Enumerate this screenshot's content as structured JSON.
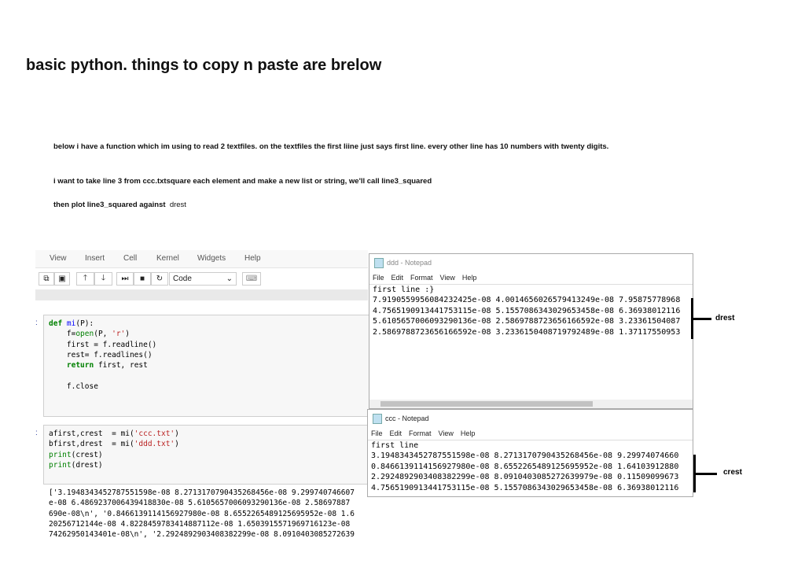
{
  "title": "basic python. things to copy n paste are brelow",
  "question": {
    "p1": "below i have a function which im using to read 2 textfiles. on the textfiles the first liine just says first line. every other line has 10 numbers with twenty digits.",
    "p2": "i want to take line 3 from ccc.txtsquare each element and make a new list or string, we'll call line3_squared",
    "p3": "then plot line3_squared against",
    "p3b": "drest"
  },
  "jupyter": {
    "menu": [
      "View",
      "Insert",
      "Cell",
      "Kernel",
      "Widgets",
      "Help"
    ],
    "cell_type": "Code",
    "prompt": ":",
    "cell1": [
      "def mi(P):",
      "    f=open(P, 'r')",
      "    first = f.readline()",
      "    rest= f.readlines()",
      "    return first, rest",
      "",
      "    f.close"
    ],
    "cell2": [
      "afirst,crest  = mi('ccc.txt')",
      "bfirst,drest  = mi('ddd.txt')",
      "print(crest)",
      "print(drest)"
    ],
    "output": [
      "['3.1948343452787551598e-08 8.2713170790435268456e-08 9.299740746607",
      "e-08 6.4869237006439418830e-08 5.6105657006093290136e-08 2.58697887",
      "690e-08\\n', '0.8466139114156927980e-08 8.6552265489125695952e-08 1.6",
      "20256712144e-08 4.8228459783414887112e-08 1.6503915571969716123e-08 ",
      "74262950143401e-08\\n', '2.2924892903408382299e-08 8.0910403085272639"
    ]
  },
  "ddd": {
    "title": "ddd - Notepad",
    "menu": [
      "File",
      "Edit",
      "Format",
      "View",
      "Help"
    ],
    "lines": [
      "first line :}",
      "7.9190559956084232425e-08 4.0014656026579413249e-08 7.95875778968",
      "4.7565190913441753115e-08 5.1557086343029653458e-08 6.36938012116",
      "5.6105657006093290136e-08 2.5869788723656166592e-08 3.23361504087",
      "2.5869788723656166592e-08 3.2336150408719792489e-08 1.37117550953"
    ],
    "annotation": "drest"
  },
  "ccc": {
    "title": "ccc - Notepad",
    "menu": [
      "File",
      "Edit",
      "Format",
      "View",
      "Help"
    ],
    "lines": [
      "first line",
      "3.1948343452787551598e-08 8.2713170790435268456e-08 9.29974074660",
      "0.8466139114156927980e-08 8.6552265489125695952e-08 1.64103912880",
      "2.2924892903408382299e-08 8.0910403085272639979e-08 0.11509099673",
      "4.7565190913441753115e-08 5.1557086343029653458e-08 6.36938012116"
    ],
    "annotation": "crest"
  }
}
